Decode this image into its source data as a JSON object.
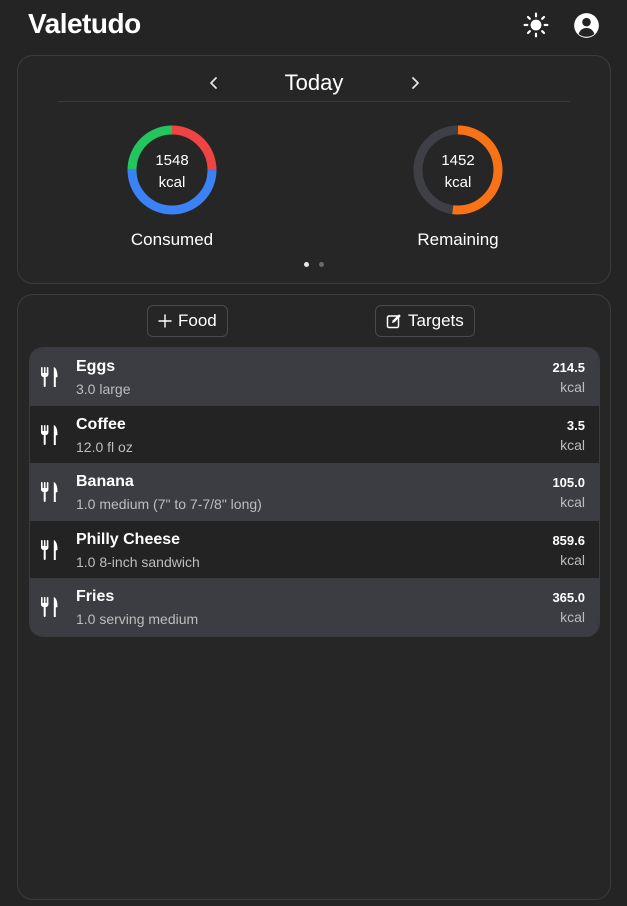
{
  "header": {
    "app_title": "Valetudo",
    "theme_icon": "sun-icon",
    "account_icon": "account-circle-icon"
  },
  "summary": {
    "date_label": "Today",
    "consumed": {
      "value": "1548",
      "unit": "kcal",
      "caption": "Consumed"
    },
    "remaining": {
      "value": "1452",
      "unit": "kcal",
      "caption": "Remaining"
    },
    "consumed_ring_segments": [
      {
        "color": "#ef4444",
        "fraction": 0.25
      },
      {
        "color": "#3b82f6",
        "fraction": 0.5
      },
      {
        "color": "#22c55e",
        "fraction": 0.25
      }
    ],
    "remaining_ring": {
      "track_color": "#3f3f46",
      "fill_color": "#f97316",
      "fraction": 0.52
    },
    "page_dots": 2,
    "active_dot": 0
  },
  "actions": {
    "add_food_label": "Food",
    "targets_label": "Targets"
  },
  "foods": [
    {
      "name": "Eggs",
      "portion": "3.0 large",
      "kcal": "214.5",
      "unit": "kcal"
    },
    {
      "name": "Coffee",
      "portion": "12.0 fl oz",
      "kcal": "3.5",
      "unit": "kcal"
    },
    {
      "name": "Banana",
      "portion": "1.0 medium (7\" to 7-7/8\" long)",
      "kcal": "105.0",
      "unit": "kcal"
    },
    {
      "name": "Philly Cheese",
      "portion": "1.0 8-inch sandwich",
      "kcal": "859.6",
      "unit": "kcal"
    },
    {
      "name": "Fries",
      "portion": "1.0 serving medium",
      "kcal": "365.0",
      "unit": "kcal"
    }
  ]
}
